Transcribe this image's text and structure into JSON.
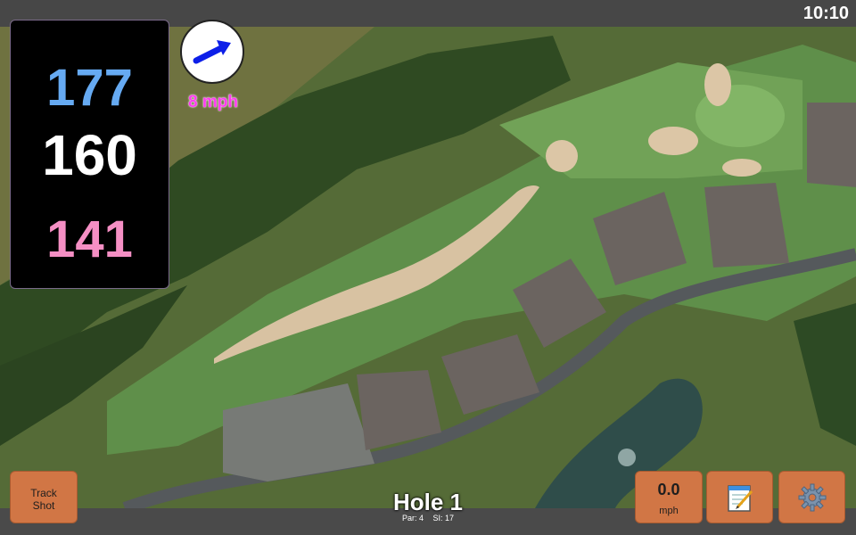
{
  "status": {
    "time": "10:10"
  },
  "distances": {
    "back": "177",
    "middle": "160",
    "front": "141"
  },
  "wind": {
    "speed": "8 mph",
    "direction_icon": "arrow-icon"
  },
  "hole": {
    "title": "Hole 1",
    "par": "Par: 4",
    "si": "SI: 17"
  },
  "buttons": {
    "track_shot_line1": "Track",
    "track_shot_line2": "Shot",
    "speed_value": "0.0",
    "speed_unit": "mph",
    "notes_icon": "notepad-icon",
    "settings_icon": "gear-icon"
  },
  "colors": {
    "back": "#66aaf2",
    "middle": "#ffffff",
    "front": "#f58fc4",
    "wind": "#ff3bf0",
    "button": "#d17645"
  }
}
